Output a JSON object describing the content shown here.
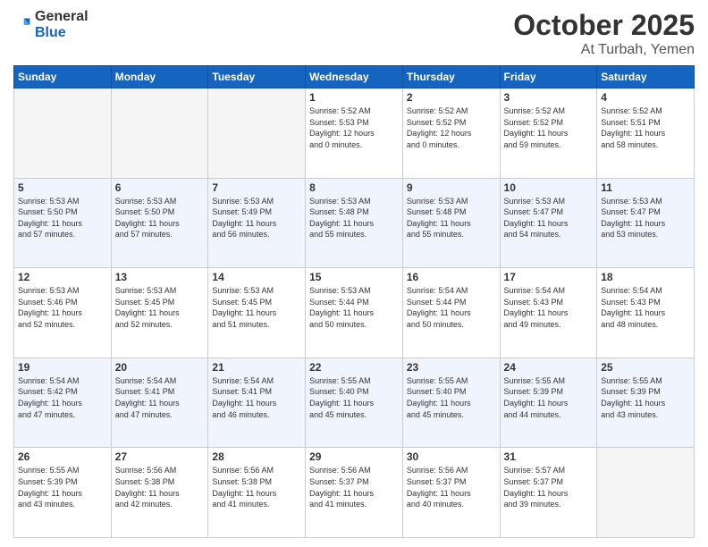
{
  "header": {
    "logo_general": "General",
    "logo_blue": "Blue",
    "month": "October 2025",
    "location": "At Turbah, Yemen"
  },
  "days_of_week": [
    "Sunday",
    "Monday",
    "Tuesday",
    "Wednesday",
    "Thursday",
    "Friday",
    "Saturday"
  ],
  "weeks": [
    {
      "shade": false,
      "days": [
        {
          "num": "",
          "info": ""
        },
        {
          "num": "",
          "info": ""
        },
        {
          "num": "",
          "info": ""
        },
        {
          "num": "1",
          "info": "Sunrise: 5:52 AM\nSunset: 5:53 PM\nDaylight: 12 hours\nand 0 minutes."
        },
        {
          "num": "2",
          "info": "Sunrise: 5:52 AM\nSunset: 5:52 PM\nDaylight: 12 hours\nand 0 minutes."
        },
        {
          "num": "3",
          "info": "Sunrise: 5:52 AM\nSunset: 5:52 PM\nDaylight: 11 hours\nand 59 minutes."
        },
        {
          "num": "4",
          "info": "Sunrise: 5:52 AM\nSunset: 5:51 PM\nDaylight: 11 hours\nand 58 minutes."
        }
      ]
    },
    {
      "shade": true,
      "days": [
        {
          "num": "5",
          "info": "Sunrise: 5:53 AM\nSunset: 5:50 PM\nDaylight: 11 hours\nand 57 minutes."
        },
        {
          "num": "6",
          "info": "Sunrise: 5:53 AM\nSunset: 5:50 PM\nDaylight: 11 hours\nand 57 minutes."
        },
        {
          "num": "7",
          "info": "Sunrise: 5:53 AM\nSunset: 5:49 PM\nDaylight: 11 hours\nand 56 minutes."
        },
        {
          "num": "8",
          "info": "Sunrise: 5:53 AM\nSunset: 5:48 PM\nDaylight: 11 hours\nand 55 minutes."
        },
        {
          "num": "9",
          "info": "Sunrise: 5:53 AM\nSunset: 5:48 PM\nDaylight: 11 hours\nand 55 minutes."
        },
        {
          "num": "10",
          "info": "Sunrise: 5:53 AM\nSunset: 5:47 PM\nDaylight: 11 hours\nand 54 minutes."
        },
        {
          "num": "11",
          "info": "Sunrise: 5:53 AM\nSunset: 5:47 PM\nDaylight: 11 hours\nand 53 minutes."
        }
      ]
    },
    {
      "shade": false,
      "days": [
        {
          "num": "12",
          "info": "Sunrise: 5:53 AM\nSunset: 5:46 PM\nDaylight: 11 hours\nand 52 minutes."
        },
        {
          "num": "13",
          "info": "Sunrise: 5:53 AM\nSunset: 5:45 PM\nDaylight: 11 hours\nand 52 minutes."
        },
        {
          "num": "14",
          "info": "Sunrise: 5:53 AM\nSunset: 5:45 PM\nDaylight: 11 hours\nand 51 minutes."
        },
        {
          "num": "15",
          "info": "Sunrise: 5:53 AM\nSunset: 5:44 PM\nDaylight: 11 hours\nand 50 minutes."
        },
        {
          "num": "16",
          "info": "Sunrise: 5:54 AM\nSunset: 5:44 PM\nDaylight: 11 hours\nand 50 minutes."
        },
        {
          "num": "17",
          "info": "Sunrise: 5:54 AM\nSunset: 5:43 PM\nDaylight: 11 hours\nand 49 minutes."
        },
        {
          "num": "18",
          "info": "Sunrise: 5:54 AM\nSunset: 5:43 PM\nDaylight: 11 hours\nand 48 minutes."
        }
      ]
    },
    {
      "shade": true,
      "days": [
        {
          "num": "19",
          "info": "Sunrise: 5:54 AM\nSunset: 5:42 PM\nDaylight: 11 hours\nand 47 minutes."
        },
        {
          "num": "20",
          "info": "Sunrise: 5:54 AM\nSunset: 5:41 PM\nDaylight: 11 hours\nand 47 minutes."
        },
        {
          "num": "21",
          "info": "Sunrise: 5:54 AM\nSunset: 5:41 PM\nDaylight: 11 hours\nand 46 minutes."
        },
        {
          "num": "22",
          "info": "Sunrise: 5:55 AM\nSunset: 5:40 PM\nDaylight: 11 hours\nand 45 minutes."
        },
        {
          "num": "23",
          "info": "Sunrise: 5:55 AM\nSunset: 5:40 PM\nDaylight: 11 hours\nand 45 minutes."
        },
        {
          "num": "24",
          "info": "Sunrise: 5:55 AM\nSunset: 5:39 PM\nDaylight: 11 hours\nand 44 minutes."
        },
        {
          "num": "25",
          "info": "Sunrise: 5:55 AM\nSunset: 5:39 PM\nDaylight: 11 hours\nand 43 minutes."
        }
      ]
    },
    {
      "shade": false,
      "days": [
        {
          "num": "26",
          "info": "Sunrise: 5:55 AM\nSunset: 5:39 PM\nDaylight: 11 hours\nand 43 minutes."
        },
        {
          "num": "27",
          "info": "Sunrise: 5:56 AM\nSunset: 5:38 PM\nDaylight: 11 hours\nand 42 minutes."
        },
        {
          "num": "28",
          "info": "Sunrise: 5:56 AM\nSunset: 5:38 PM\nDaylight: 11 hours\nand 41 minutes."
        },
        {
          "num": "29",
          "info": "Sunrise: 5:56 AM\nSunset: 5:37 PM\nDaylight: 11 hours\nand 41 minutes."
        },
        {
          "num": "30",
          "info": "Sunrise: 5:56 AM\nSunset: 5:37 PM\nDaylight: 11 hours\nand 40 minutes."
        },
        {
          "num": "31",
          "info": "Sunrise: 5:57 AM\nSunset: 5:37 PM\nDaylight: 11 hours\nand 39 minutes."
        },
        {
          "num": "",
          "info": ""
        }
      ]
    }
  ]
}
